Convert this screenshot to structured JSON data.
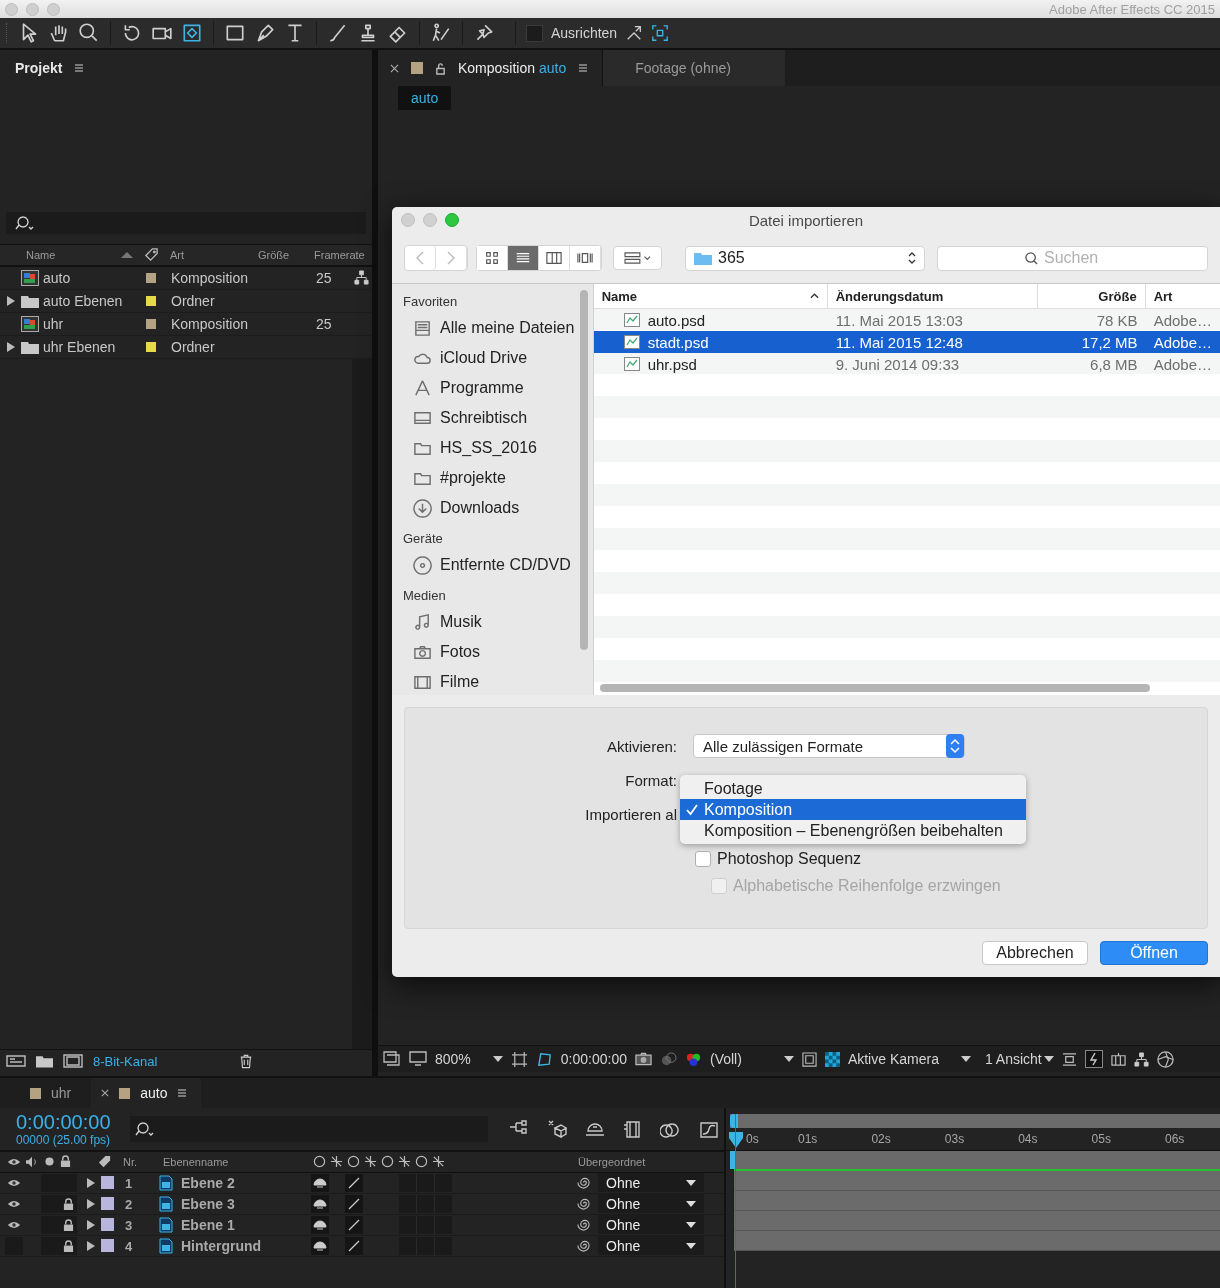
{
  "app_title": "Adobe After Effects CC 2015",
  "toolbar": {
    "align": {
      "label": "Ausrichten",
      "checked": false
    }
  },
  "project": {
    "title": "Projekt",
    "columns": [
      "Name",
      "Art",
      "Größe",
      "Framerate"
    ],
    "items": [
      {
        "name": "auto",
        "kind": "composition",
        "type": "Komposition",
        "framerate": "25",
        "color": "#b4a282"
      },
      {
        "name": "auto Ebenen",
        "kind": "folder",
        "type": "Ordner",
        "color": "#e6d94c"
      },
      {
        "name": "uhr",
        "kind": "composition",
        "type": "Komposition",
        "framerate": "25",
        "color": "#b4a282"
      },
      {
        "name": "uhr Ebenen",
        "kind": "folder",
        "type": "Ordner",
        "color": "#e6d94c"
      }
    ],
    "bit_depth": "8-Bit-Kanal"
  },
  "composition": {
    "tabs": [
      {
        "label": "Komposition",
        "name": "auto",
        "selected": true
      },
      {
        "label": "Footage (ohne)",
        "selected": false
      }
    ],
    "breadcrumb": "auto",
    "footer": {
      "zoom": "800%",
      "timecode": "0:00:00:00",
      "resolution": "(Voll)",
      "camera": "Aktive Kamera",
      "views": "1 Ansicht"
    }
  },
  "dialog": {
    "title": "Datei importieren",
    "location": "365",
    "search_placeholder": "Suchen",
    "view_modes": [
      {
        "kind": "icons",
        "selected": false
      },
      {
        "kind": "list",
        "selected": true
      },
      {
        "kind": "columns",
        "selected": false
      },
      {
        "kind": "coverflow",
        "selected": false
      }
    ],
    "sidebar": [
      {
        "heading": "Favoriten",
        "items": [
          {
            "label": "Alle meine Dateien",
            "kind": "files"
          },
          {
            "label": "iCloud Drive",
            "kind": "cloud"
          },
          {
            "label": "Programme",
            "kind": "apps"
          },
          {
            "label": "Schreibtisch",
            "kind": "desktop"
          },
          {
            "label": "HS_SS_2016",
            "kind": "folder"
          },
          {
            "label": "#projekte",
            "kind": "folder"
          },
          {
            "label": "Downloads",
            "kind": "download"
          }
        ]
      },
      {
        "heading": "Geräte",
        "items": [
          {
            "label": "Entfernte CD/DVD",
            "kind": "disc"
          }
        ]
      },
      {
        "heading": "Medien",
        "items": [
          {
            "label": "Musik",
            "kind": "music"
          },
          {
            "label": "Fotos",
            "kind": "photo"
          },
          {
            "label": "Filme",
            "kind": "film"
          }
        ]
      }
    ],
    "columns": [
      "Name",
      "Änderungsdatum",
      "Größe",
      "Art"
    ],
    "files": [
      {
        "name": "auto.psd",
        "date": "11. Mai 2015 13:03",
        "size": "78 KB",
        "type": "Adobe…",
        "selected": false
      },
      {
        "name": "stadt.psd",
        "date": "11. Mai 2015 12:48",
        "size": "17,2 MB",
        "type": "Adobe…",
        "selected": true
      },
      {
        "name": "uhr.psd",
        "date": "9. Juni 2014 09:33",
        "size": "6,8 MB",
        "type": "Adobe…",
        "selected": false
      }
    ],
    "enable": {
      "label": "Aktivieren:",
      "value": "Alle zulässigen Formate"
    },
    "format": {
      "label": "Format:"
    },
    "import_as": {
      "label": "Importieren al",
      "options": [
        {
          "label": "Footage",
          "selected": false
        },
        {
          "label": "Komposition",
          "selected": true
        },
        {
          "label": "Komposition – Ebenengrößen beibehalten",
          "selected": false
        }
      ]
    },
    "checkboxes": [
      {
        "label": "Photoshop Sequenz",
        "checked": false,
        "disabled": false
      },
      {
        "label": "Alphabetische Reihenfolge erzwingen",
        "checked": false,
        "disabled": true
      }
    ],
    "buttons": [
      {
        "label": "Abbrechen",
        "kind": "secondary"
      },
      {
        "label": "Öffnen",
        "kind": "primary"
      }
    ]
  },
  "timeline": {
    "tabs": [
      {
        "label": "uhr",
        "selected": false
      },
      {
        "label": "auto",
        "selected": true
      }
    ],
    "timecode": "0:00:00:00",
    "fps": "00000 (25.00 fps)",
    "columns": {
      "number": "Nr.",
      "name": "Ebenenname",
      "parent": "Übergeordnet"
    },
    "layers": [
      {
        "number": "1",
        "name": "Ebene 2",
        "visible": true,
        "locked": false,
        "parent": "Ohne"
      },
      {
        "number": "2",
        "name": "Ebene 3",
        "visible": true,
        "locked": true,
        "parent": "Ohne"
      },
      {
        "number": "3",
        "name": "Ebene 1",
        "visible": true,
        "locked": true,
        "parent": "Ohne"
      },
      {
        "number": "4",
        "name": "Hintergrund",
        "visible": false,
        "locked": true,
        "parent": "Ohne"
      }
    ],
    "ruler": [
      "0s",
      "01s",
      "02s",
      "03s",
      "04s",
      "05s",
      "06s"
    ]
  }
}
